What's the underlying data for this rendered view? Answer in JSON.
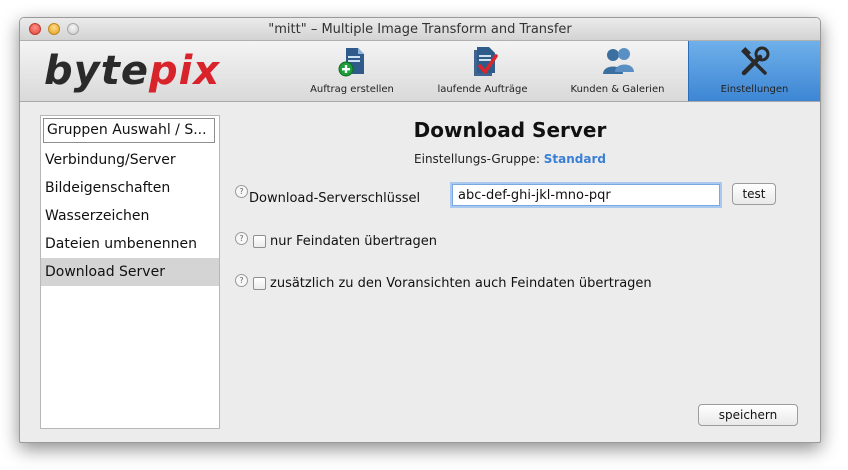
{
  "window": {
    "title": "\"mitt\" – Multiple Image Transform and Transfer"
  },
  "logo": {
    "part1": "byte",
    "part2": "pix"
  },
  "toolbar": {
    "items": [
      {
        "label": "Auftrag erstellen",
        "icon": "document-add-icon"
      },
      {
        "label": "laufende Aufträge",
        "icon": "document-check-icon"
      },
      {
        "label": "Kunden & Galerien",
        "icon": "users-icon"
      },
      {
        "label": "Einstellungen",
        "icon": "tools-icon",
        "active": true
      }
    ]
  },
  "sidebar": {
    "header": "Gruppen Auswahl / S...",
    "items": [
      {
        "label": "Verbindung/Server"
      },
      {
        "label": "Bildeigenschaften"
      },
      {
        "label": "Wasserzeichen"
      },
      {
        "label": "Dateien umbenennen"
      },
      {
        "label": "Download Server",
        "selected": true
      }
    ]
  },
  "panel": {
    "title": "Download Server",
    "group_label": "Einstellungs-Gruppe:",
    "group_value": "Standard",
    "key_label": "Download-Serverschlüssel",
    "key_value": "abc-def-ghi-jkl-mno-pqr",
    "test_button": "test",
    "option1": {
      "label": "nur Feindaten übertragen",
      "checked": false
    },
    "option2": {
      "label": "zusätzlich zu den Voransichten auch Feindaten übertragen",
      "checked": false
    },
    "save_button": "speichern"
  },
  "colors": {
    "accent": "#3a7fd6",
    "logo_red": "#d8232a",
    "active_tab": "#4a90dc"
  }
}
